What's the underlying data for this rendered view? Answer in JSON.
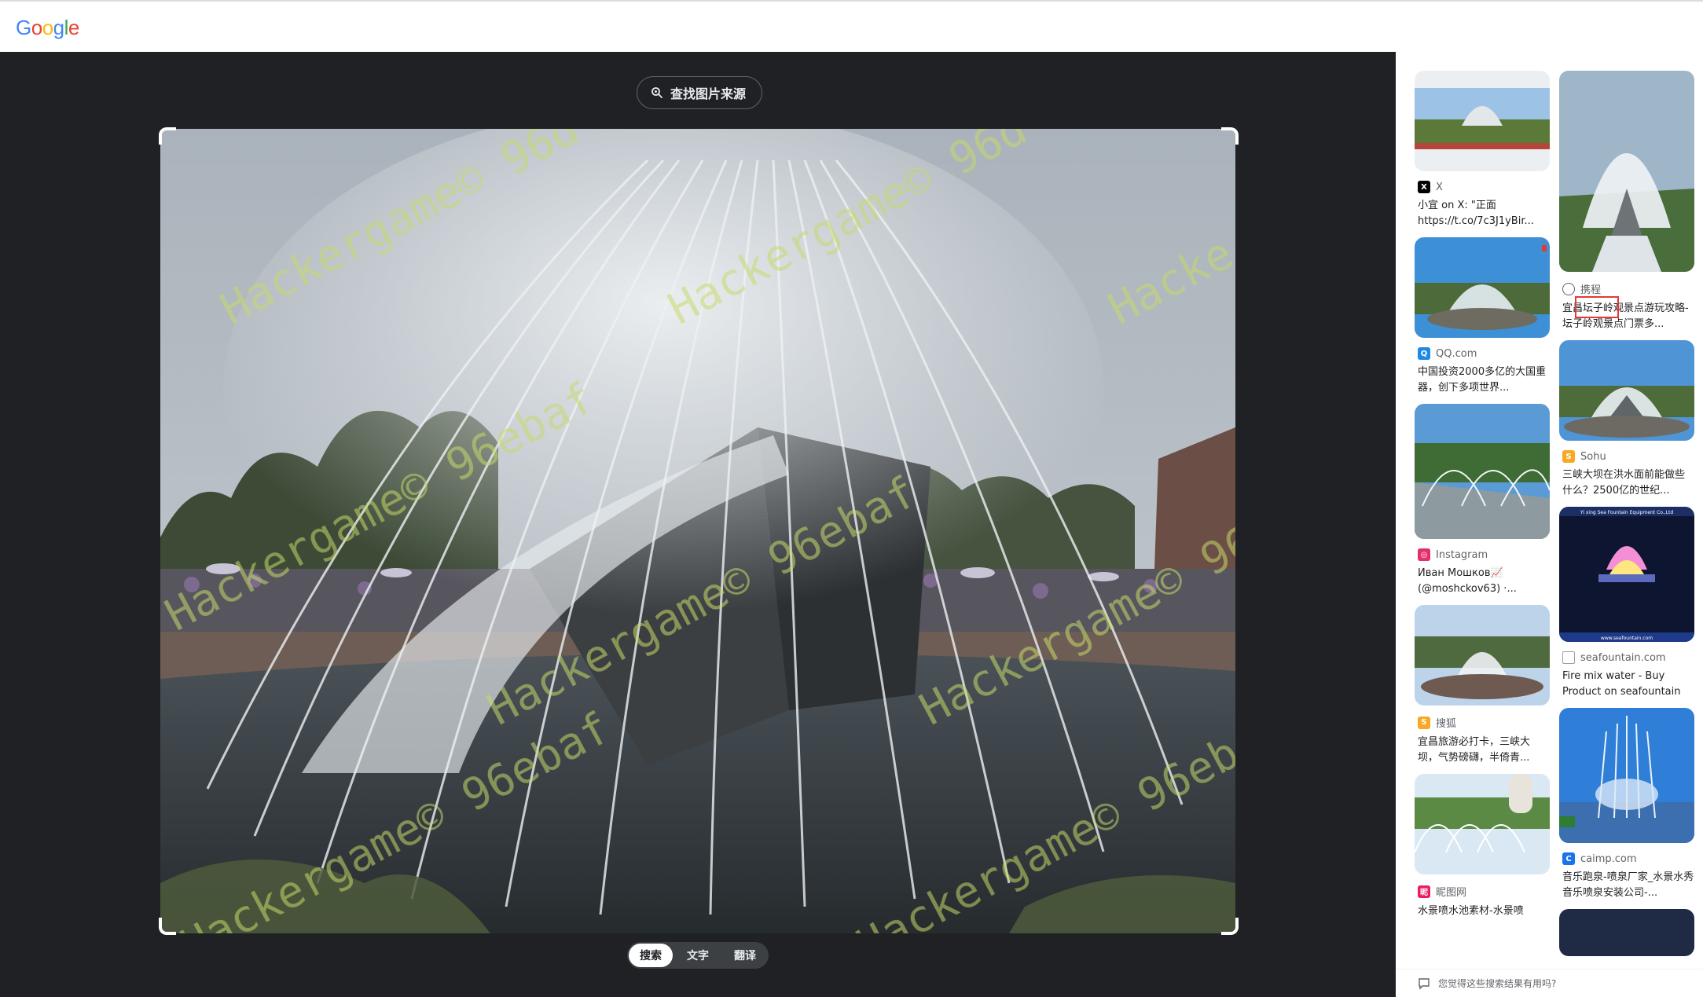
{
  "header": {
    "logo_letters": [
      "G",
      "o",
      "o",
      "g",
      "l",
      "e"
    ],
    "logo_colors": [
      "#4285F4",
      "#EA4335",
      "#FBBC05",
      "#4285F4",
      "#34A853",
      "#EA4335"
    ]
  },
  "viewer": {
    "find_source_label": "查找图片来源",
    "watermark_text": "Hackergame© 96d",
    "watermark_text_2": "Hackergame© 96ebaf",
    "watermark_text_3": "Hacke",
    "tabs": [
      {
        "label": "搜索",
        "active": true
      },
      {
        "label": "文字",
        "active": false
      },
      {
        "label": "翻译",
        "active": false
      }
    ]
  },
  "results": {
    "col1": [
      {
        "source": "X",
        "favicon": "x-logo",
        "favicon_color": "#000000",
        "title": "小宜 on X: \"正面 https://t.co/7c3J1yBir..."
      },
      {
        "source": "QQ.com",
        "favicon": "qq-logo",
        "favicon_color": "#1e88e5",
        "title": "中国投资2000多亿的大国重器，创下多项世界..."
      },
      {
        "source": "Instagram",
        "favicon": "instagram-logo",
        "favicon_color": "#e1306c",
        "title": "Иван Мошков📈 (@moshckov63) ·..."
      },
      {
        "source": "搜狐",
        "favicon": "sohu-logo",
        "favicon_color": "#f9a825",
        "title": "宜昌旅游必打卡，三峡大坝，气势磅礴，半倚青..."
      },
      {
        "source": "昵图网",
        "favicon": "nipic-logo",
        "favicon_color": "#e91e63",
        "title": "水景喷水池素材-水景喷"
      }
    ],
    "col2": [
      {
        "source": "携程",
        "favicon": "globe-icon",
        "favicon_color": "#5f6368",
        "title": "宜昌坛子岭观景点游玩攻略-坛子岭观景点门票多..."
      },
      {
        "source": "Sohu",
        "favicon": "sohu-logo",
        "favicon_color": "#f9a825",
        "title": "三峡大坝在洪水面前能做些什么？2500亿的世纪..."
      },
      {
        "source": "seafountain.com",
        "favicon": "page-icon",
        "favicon_color": "#9aa0a6",
        "title": "Fire mix water - Buy Product on seafountain"
      },
      {
        "source": "caimp.com",
        "favicon": "caimp-logo",
        "favicon_color": "#1a73e8",
        "title": "音乐跑泉-喷泉厂家_水景水秀音乐喷泉安装公司-..."
      }
    ],
    "seafountain_banner": "Yi xing Sea Fountain Equipment Co.,Ltd",
    "seafountain_url": "www.seafountain.com",
    "feedback_label": "您觉得这些搜索结果有用吗?"
  }
}
